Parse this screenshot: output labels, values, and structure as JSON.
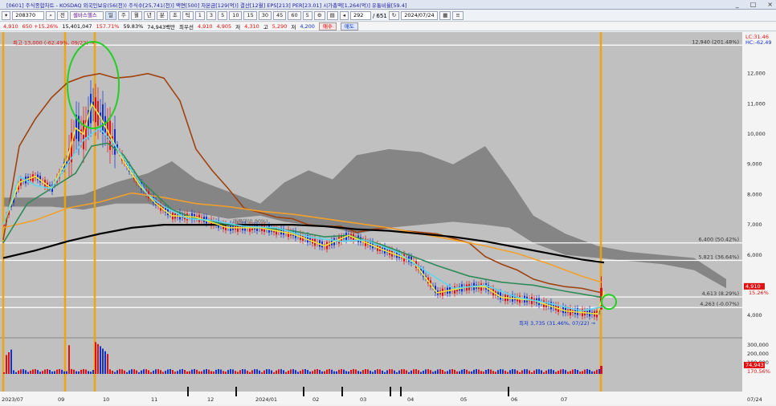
{
  "window": {
    "title": "[0601] 주식종합차트 - KOSDAQ 외국인보유(56(천)) 주식수[25,741(천)] 액면[500] 자본금[129(억)] 결산[12월] EPS[213] PER[23.01] 시가총액[1,264(억)] 유통비율[59.4]",
    "controls": [
      "_",
      "□",
      "×"
    ]
  },
  "toolbar": {
    "code": "208370",
    "market": "전",
    "stock_name": "셀바스헬스",
    "periods": [
      "주",
      "월",
      "년",
      "분",
      "초",
      "틱"
    ],
    "intervals": [
      "1",
      "3",
      "5",
      "10",
      "15",
      "30",
      "45",
      "60",
      "5"
    ],
    "count": "292",
    "total": "651",
    "date": "2024/07/24"
  },
  "quote": {
    "price": "4,910",
    "change": "650 +15.26%",
    "volume": "15,401,047",
    "volume_ratio": "157.71%",
    "turnover_rate": "59.83%",
    "amount": "74,943백만",
    "priority_label": "최우선",
    "ask": "4,910",
    "bid": "4,905",
    "low_label": "저",
    "low": "4,310",
    "high_label": "고",
    "high": "5,290",
    "open_label": "저",
    "open": "4,200",
    "buy_label": "매수",
    "sell_label": "매도"
  },
  "chart_data": {
    "type": "candlestick",
    "price_ylim": [
      3500,
      13000
    ],
    "price_ticks": [
      "12,000",
      "11,000",
      "10,000",
      "9,000",
      "8,000",
      "7,000",
      "6,000",
      "5,000",
      "4,000"
    ],
    "volume_ticks": [
      "300,000",
      "200,000",
      "100,000"
    ],
    "x_ticks": [
      "2023/07",
      "09",
      "10",
      "11",
      "12",
      "2024/01",
      "02",
      "03",
      "04",
      "05",
      "06",
      "07"
    ],
    "x_right_label": "07/24",
    "corner_labels": [
      "LC:31.46",
      "HC:-62.49"
    ],
    "annotations": {
      "high": "최고 13,000 (-62.49%, 09/22) →",
      "low": "최저 3,735 (31.46%, 07/22) →",
      "mid_label": "매물대(0.00%)"
    },
    "horizontal_lines": [
      {
        "value": 12940,
        "label": "12,940 (201.48%)"
      },
      {
        "value": 6400,
        "label": "6,400 (50.42%)"
      },
      {
        "value": 5821,
        "label": "5,821 (36.64%)"
      },
      {
        "value": 4613,
        "label": "4,613 (8.29%)"
      },
      {
        "value": 4263,
        "label": "4,263 (-0.07%)"
      }
    ],
    "current_price": {
      "value": 4910,
      "label": "4,910",
      "change": "15.26%"
    },
    "current_volume": {
      "label": "74,943",
      "ratio": "170.56%"
    },
    "series": [
      {
        "name": "MA60",
        "color": "#a0420f",
        "points": [
          [
            0,
            6500
          ],
          [
            20,
            9600
          ],
          [
            40,
            10500
          ],
          [
            60,
            11200
          ],
          [
            80,
            11700
          ],
          [
            100,
            11900
          ],
          [
            120,
            12000
          ],
          [
            140,
            11850
          ],
          [
            160,
            11900
          ],
          [
            180,
            12000
          ],
          [
            200,
            11850
          ],
          [
            220,
            11100
          ],
          [
            240,
            9500
          ],
          [
            260,
            8800
          ],
          [
            280,
            8200
          ],
          [
            300,
            7550
          ],
          [
            320,
            7400
          ],
          [
            340,
            7250
          ],
          [
            360,
            7200
          ],
          [
            380,
            7000
          ],
          [
            400,
            6950
          ],
          [
            420,
            6950
          ],
          [
            440,
            6750
          ],
          [
            460,
            6850
          ],
          [
            480,
            6900
          ],
          [
            500,
            6800
          ],
          [
            520,
            6750
          ],
          [
            540,
            6700
          ],
          [
            560,
            6550
          ],
          [
            580,
            6400
          ],
          [
            600,
            5950
          ],
          [
            620,
            5700
          ],
          [
            640,
            5500
          ],
          [
            660,
            5200
          ],
          [
            680,
            5050
          ],
          [
            700,
            4950
          ],
          [
            720,
            4900
          ],
          [
            745,
            4750
          ]
        ]
      },
      {
        "name": "MA120",
        "color": "#f3a02a",
        "points": [
          [
            0,
            6900
          ],
          [
            40,
            7150
          ],
          [
            80,
            7550
          ],
          [
            120,
            7750
          ],
          [
            160,
            8050
          ],
          [
            200,
            7900
          ],
          [
            240,
            7700
          ],
          [
            280,
            7600
          ],
          [
            320,
            7450
          ],
          [
            360,
            7350
          ],
          [
            400,
            7200
          ],
          [
            440,
            7050
          ],
          [
            480,
            6900
          ],
          [
            520,
            6700
          ],
          [
            560,
            6500
          ],
          [
            600,
            6300
          ],
          [
            640,
            6050
          ],
          [
            680,
            5700
          ],
          [
            720,
            5300
          ],
          [
            745,
            5100
          ]
        ]
      },
      {
        "name": "MA240",
        "color": "#000000",
        "points": [
          [
            0,
            5900
          ],
          [
            40,
            6150
          ],
          [
            80,
            6450
          ],
          [
            120,
            6700
          ],
          [
            160,
            6900
          ],
          [
            200,
            7000
          ],
          [
            240,
            7000
          ],
          [
            280,
            7000
          ],
          [
            320,
            7000
          ],
          [
            360,
            7000
          ],
          [
            400,
            6950
          ],
          [
            440,
            6850
          ],
          [
            480,
            6800
          ],
          [
            520,
            6700
          ],
          [
            560,
            6600
          ],
          [
            600,
            6450
          ],
          [
            640,
            6250
          ],
          [
            680,
            6050
          ],
          [
            720,
            5850
          ],
          [
            748,
            5750
          ]
        ]
      },
      {
        "name": "MA20",
        "color": "#2e8b57",
        "points": [
          [
            0,
            6400
          ],
          [
            30,
            7700
          ],
          [
            60,
            8200
          ],
          [
            90,
            8700
          ],
          [
            110,
            9600
          ],
          [
            130,
            9700
          ],
          [
            150,
            9300
          ],
          [
            170,
            8500
          ],
          [
            190,
            8000
          ],
          [
            210,
            7500
          ],
          [
            240,
            7200
          ],
          [
            280,
            7000
          ],
          [
            320,
            6900
          ],
          [
            360,
            6800
          ],
          [
            400,
            6600
          ],
          [
            430,
            6650
          ],
          [
            470,
            6350
          ],
          [
            510,
            5950
          ],
          [
            540,
            5650
          ],
          [
            580,
            5300
          ],
          [
            620,
            5100
          ],
          [
            660,
            5000
          ],
          [
            700,
            4800
          ],
          [
            745,
            4600
          ]
        ]
      },
      {
        "name": "MA5",
        "color": "#f5e63a",
        "points": [
          [
            0,
            7000
          ],
          [
            20,
            8400
          ],
          [
            40,
            8600
          ],
          [
            60,
            8200
          ],
          [
            80,
            9200
          ],
          [
            90,
            10200
          ],
          [
            100,
            10000
          ],
          [
            110,
            11000
          ],
          [
            120,
            10600
          ],
          [
            130,
            10100
          ],
          [
            150,
            9100
          ],
          [
            170,
            8300
          ],
          [
            190,
            7700
          ],
          [
            210,
            7300
          ],
          [
            240,
            7250
          ],
          [
            280,
            6900
          ],
          [
            320,
            6900
          ],
          [
            360,
            6700
          ],
          [
            400,
            6300
          ],
          [
            430,
            6650
          ],
          [
            470,
            6200
          ],
          [
            510,
            5800
          ],
          [
            540,
            4750
          ],
          [
            580,
            4950
          ],
          [
            600,
            4950
          ],
          [
            620,
            4600
          ],
          [
            660,
            4500
          ],
          [
            700,
            4150
          ],
          [
            740,
            4050
          ],
          [
            748,
            4800
          ]
        ]
      },
      {
        "name": "MA10",
        "color": "#5fd6f0",
        "points": [
          [
            0,
            7000
          ],
          [
            20,
            8600
          ],
          [
            40,
            8300
          ],
          [
            60,
            8200
          ],
          [
            80,
            9000
          ],
          [
            100,
            9800
          ],
          [
            120,
            10200
          ],
          [
            140,
            9600
          ],
          [
            160,
            8800
          ],
          [
            180,
            8000
          ],
          [
            200,
            7600
          ],
          [
            230,
            7200
          ],
          [
            260,
            7150
          ],
          [
            300,
            6950
          ],
          [
            340,
            6900
          ],
          [
            380,
            6600
          ],
          [
            420,
            6450
          ],
          [
            450,
            6500
          ],
          [
            490,
            6100
          ],
          [
            530,
            5400
          ],
          [
            560,
            4900
          ],
          [
            600,
            5000
          ],
          [
            640,
            4600
          ],
          [
            680,
            4400
          ],
          [
            720,
            4150
          ],
          [
            748,
            4300
          ]
        ]
      }
    ]
  }
}
